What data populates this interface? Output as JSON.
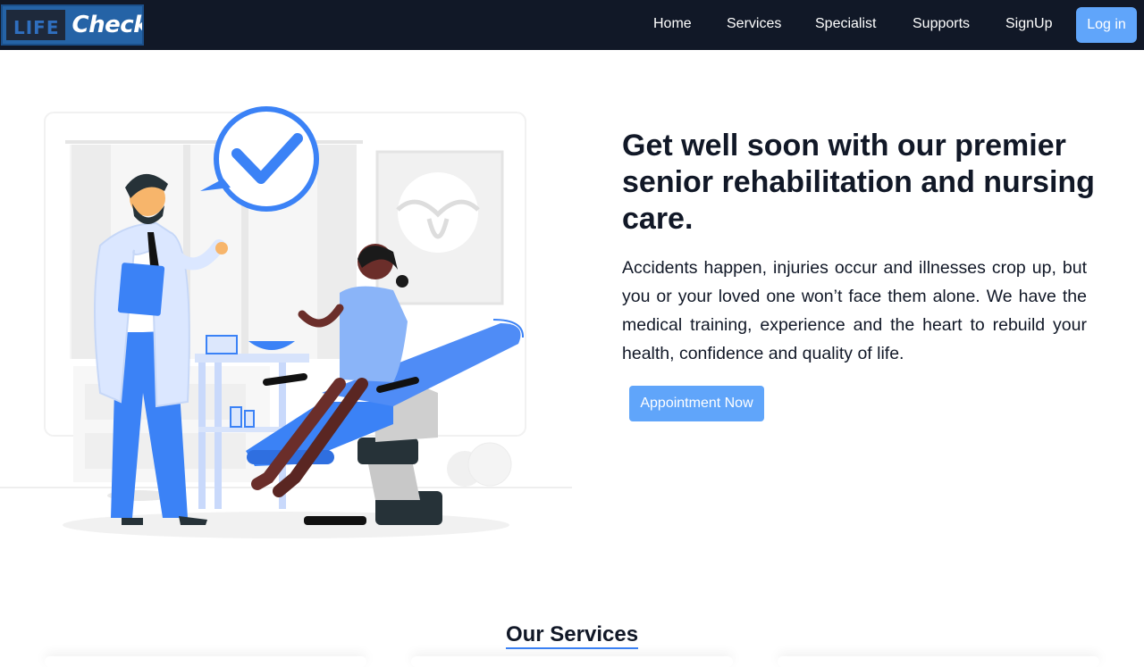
{
  "brand": {
    "logo_left": "LIFE",
    "logo_right": "Check"
  },
  "nav": {
    "items": [
      "Home",
      "Services",
      "Specialist",
      "Supports",
      "SignUp"
    ],
    "login_label": "Log in"
  },
  "hero": {
    "headline": "Get well soon with our premier senior rehabilitation and nursing care.",
    "description": "Accidents happen, injuries occur and illnesses crop up, but you or your loved one won’t face them alone. We have the medical training, experience and the heart to rebuild your health, confidence and quality of life.",
    "cta_label": "Appointment Now",
    "illustration": "doctor-patient-clinic-illustration"
  },
  "services": {
    "title": "Our Services"
  },
  "colors": {
    "navbar_bg": "#111827",
    "accent": "#60a5fa",
    "illustration_blue": "#3b82f6",
    "text": "#111827"
  }
}
